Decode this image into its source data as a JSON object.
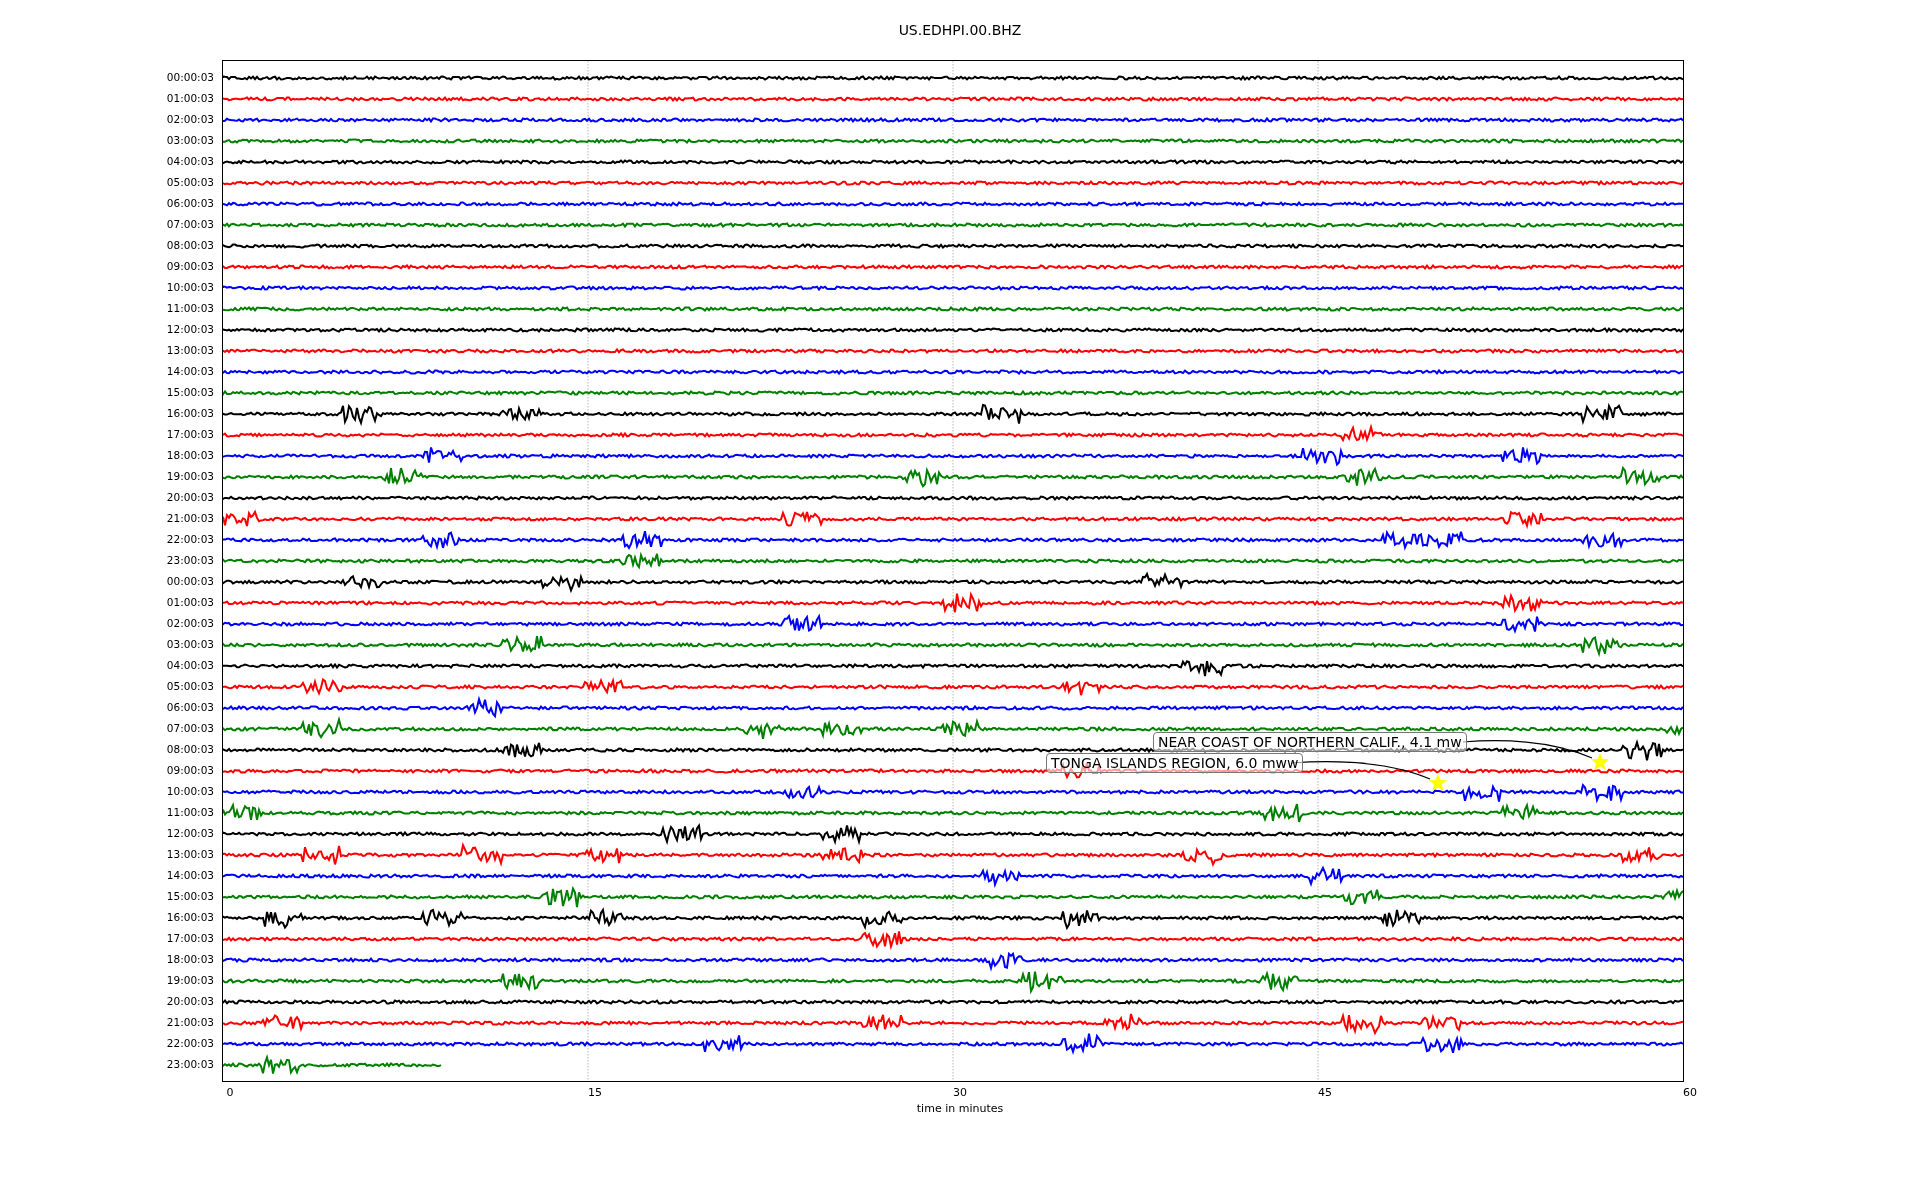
{
  "plot": {
    "title": "US.EDHPI.00.BHZ",
    "xlabel": "time in minutes",
    "xticks": [
      "0",
      "15",
      "30",
      "45",
      "60"
    ],
    "traces": [
      {
        "label": "00:00:03",
        "color": "#000000"
      },
      {
        "label": "01:00:03",
        "color": "#ff0000"
      },
      {
        "label": "02:00:03",
        "color": "#0000ff"
      },
      {
        "label": "03:00:03",
        "color": "#008000"
      },
      {
        "label": "04:00:03",
        "color": "#000000"
      },
      {
        "label": "05:00:03",
        "color": "#ff0000"
      },
      {
        "label": "06:00:03",
        "color": "#0000ff"
      },
      {
        "label": "07:00:03",
        "color": "#008000"
      },
      {
        "label": "08:00:03",
        "color": "#000000"
      },
      {
        "label": "09:00:03",
        "color": "#ff0000"
      },
      {
        "label": "10:00:03",
        "color": "#0000ff"
      },
      {
        "label": "11:00:03",
        "color": "#008000"
      },
      {
        "label": "12:00:03",
        "color": "#000000"
      },
      {
        "label": "13:00:03",
        "color": "#ff0000"
      },
      {
        "label": "14:00:03",
        "color": "#0000ff"
      },
      {
        "label": "15:00:03",
        "color": "#008000"
      },
      {
        "label": "16:00:03",
        "color": "#000000"
      },
      {
        "label": "17:00:03",
        "color": "#ff0000"
      },
      {
        "label": "18:00:03",
        "color": "#0000ff"
      },
      {
        "label": "19:00:03",
        "color": "#008000"
      },
      {
        "label": "20:00:03",
        "color": "#000000"
      },
      {
        "label": "21:00:03",
        "color": "#ff0000"
      },
      {
        "label": "22:00:03",
        "color": "#0000ff"
      },
      {
        "label": "23:00:03",
        "color": "#008000"
      },
      {
        "label": "00:00:03",
        "color": "#000000"
      },
      {
        "label": "01:00:03",
        "color": "#ff0000"
      },
      {
        "label": "02:00:03",
        "color": "#0000ff"
      },
      {
        "label": "03:00:03",
        "color": "#008000"
      },
      {
        "label": "04:00:03",
        "color": "#000000"
      },
      {
        "label": "05:00:03",
        "color": "#ff0000"
      },
      {
        "label": "06:00:03",
        "color": "#0000ff"
      },
      {
        "label": "07:00:03",
        "color": "#008000"
      },
      {
        "label": "08:00:03",
        "color": "#000000"
      },
      {
        "label": "09:00:03",
        "color": "#ff0000"
      },
      {
        "label": "10:00:03",
        "color": "#0000ff"
      },
      {
        "label": "11:00:03",
        "color": "#008000"
      },
      {
        "label": "12:00:03",
        "color": "#000000"
      },
      {
        "label": "13:00:03",
        "color": "#ff0000"
      },
      {
        "label": "14:00:03",
        "color": "#0000ff"
      },
      {
        "label": "15:00:03",
        "color": "#008000"
      },
      {
        "label": "16:00:03",
        "color": "#000000"
      },
      {
        "label": "17:00:03",
        "color": "#ff0000"
      },
      {
        "label": "18:00:03",
        "color": "#0000ff"
      },
      {
        "label": "19:00:03",
        "color": "#008000"
      },
      {
        "label": "20:00:03",
        "color": "#000000"
      },
      {
        "label": "21:00:03",
        "color": "#ff0000"
      },
      {
        "label": "22:00:03",
        "color": "#0000ff"
      },
      {
        "label": "23:00:03",
        "color": "#008000"
      }
    ],
    "annotations": [
      {
        "text": "NEAR COAST OF NORTHERN CALIF., 4.1 mw"
      },
      {
        "text": "TONGA ISLANDS REGION, 6.0 mww"
      }
    ]
  }
}
